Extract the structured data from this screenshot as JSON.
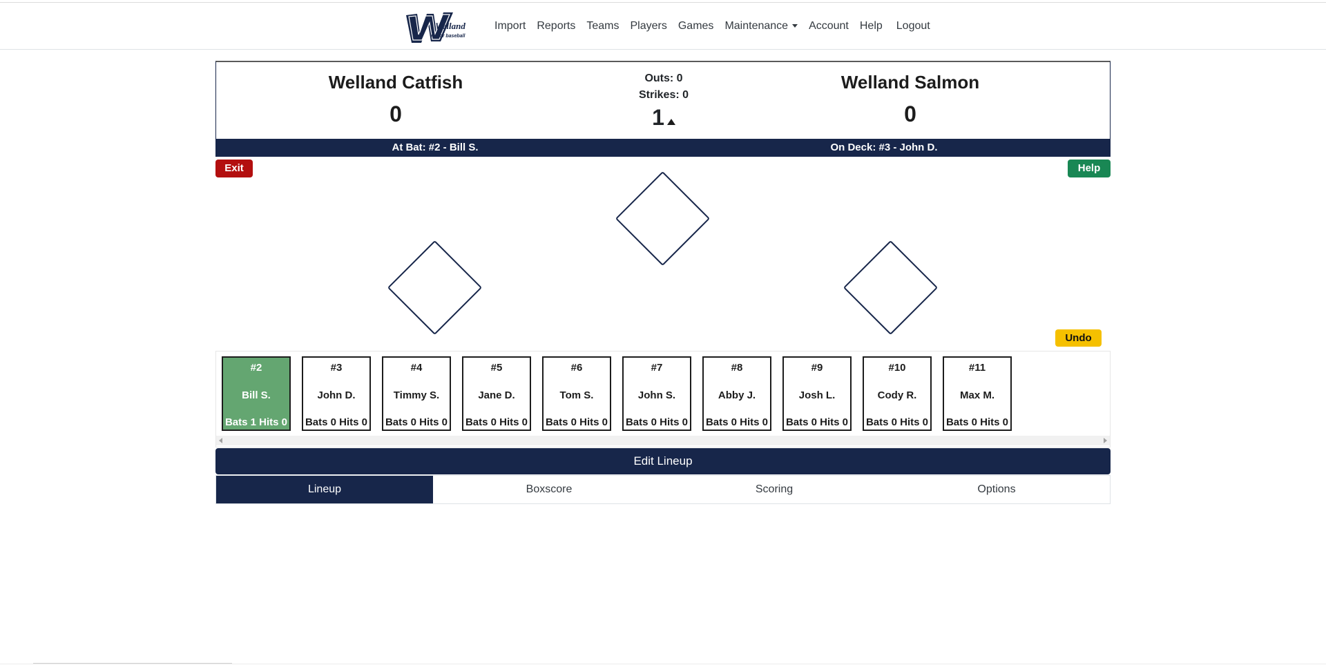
{
  "nav": {
    "logo_text": "Welland",
    "logo_subtext": "minor baseball",
    "items": [
      {
        "label": "Import"
      },
      {
        "label": "Reports"
      },
      {
        "label": "Teams"
      },
      {
        "label": "Players"
      },
      {
        "label": "Games"
      },
      {
        "label": "Maintenance",
        "dropdown": true
      },
      {
        "label": "Account"
      },
      {
        "label": "Help"
      },
      {
        "label": "Logout"
      }
    ]
  },
  "scoreboard": {
    "away": {
      "name": "Welland Catfish",
      "score": "0"
    },
    "home": {
      "name": "Welland Salmon",
      "score": "0"
    },
    "outs_label": "Outs: 0",
    "strikes_label": "Strikes: 0",
    "inning": "1",
    "inning_half": "top",
    "at_bat": "At Bat: #2 - Bill S.",
    "on_deck": "On Deck: #3 - John D."
  },
  "buttons": {
    "exit": "Exit",
    "help": "Help",
    "undo": "Undo",
    "edit_lineup": "Edit Lineup"
  },
  "lineup": [
    {
      "number": "#2",
      "name": "Bill S.",
      "stats": "Bats 1 Hits 0",
      "active": true
    },
    {
      "number": "#3",
      "name": "John D.",
      "stats": "Bats 0 Hits 0",
      "active": false
    },
    {
      "number": "#4",
      "name": "Timmy S.",
      "stats": "Bats 0 Hits 0",
      "active": false
    },
    {
      "number": "#5",
      "name": "Jane D.",
      "stats": "Bats 0 Hits 0",
      "active": false
    },
    {
      "number": "#6",
      "name": "Tom S.",
      "stats": "Bats 0 Hits 0",
      "active": false
    },
    {
      "number": "#7",
      "name": "John S.",
      "stats": "Bats 0 Hits 0",
      "active": false
    },
    {
      "number": "#8",
      "name": "Abby J.",
      "stats": "Bats 0 Hits 0",
      "active": false
    },
    {
      "number": "#9",
      "name": "Josh L.",
      "stats": "Bats 0 Hits 0",
      "active": false
    },
    {
      "number": "#10",
      "name": "Cody R.",
      "stats": "Bats 0 Hits 0",
      "active": false
    },
    {
      "number": "#11",
      "name": "Max M.",
      "stats": "Bats 0 Hits 0",
      "active": false
    }
  ],
  "tabs": [
    {
      "label": "Lineup",
      "active": true
    },
    {
      "label": "Boxscore",
      "active": false
    },
    {
      "label": "Scoring",
      "active": false
    },
    {
      "label": "Options",
      "active": false
    }
  ],
  "colors": {
    "navy": "#17264a",
    "exit_red": "#b30f0f",
    "help_green": "#198754",
    "undo_yellow": "#f5c000",
    "active_batter_green": "#64a671"
  }
}
